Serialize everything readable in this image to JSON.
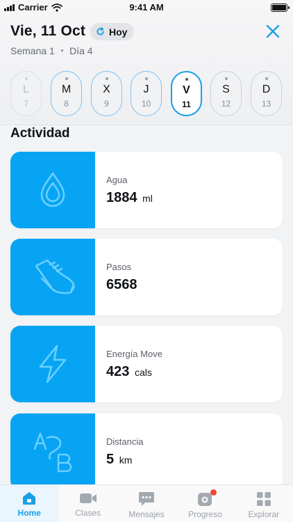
{
  "status_bar": {
    "carrier": "Carrier",
    "time": "9:41 AM"
  },
  "header": {
    "date_title": "Vie, 11 Oct",
    "today_label": "Hoy",
    "week_label": "Semana 1",
    "separator": "•",
    "day_label": "Día 4"
  },
  "week_days": [
    {
      "letter": "L",
      "number": "7"
    },
    {
      "letter": "M",
      "number": "8"
    },
    {
      "letter": "X",
      "number": "9"
    },
    {
      "letter": "J",
      "number": "10"
    },
    {
      "letter": "V",
      "number": "11"
    },
    {
      "letter": "S",
      "number": "12"
    },
    {
      "letter": "D",
      "number": "13"
    }
  ],
  "selected_day": "11",
  "section_title": "Actividad",
  "activity_cards": [
    {
      "label": "Agua",
      "value": "1884",
      "unit": "ml",
      "icon": "water-drop-icon"
    },
    {
      "label": "Pasos",
      "value": "6568",
      "unit": "",
      "icon": "sneaker-icon"
    },
    {
      "label": "Energía Move",
      "value": "423",
      "unit": "cals",
      "icon": "lightning-icon"
    },
    {
      "label": "Distancia",
      "value": "5",
      "unit": "km",
      "icon": "a-to-b-icon"
    }
  ],
  "tab_bar": [
    {
      "label": "Home",
      "icon": "home-icon",
      "active": true
    },
    {
      "label": "Clases",
      "icon": "video-camera-icon",
      "active": false
    },
    {
      "label": "Mensajes",
      "icon": "chat-bubble-icon",
      "active": false
    },
    {
      "label": "Progreso",
      "icon": "camera-progress-icon",
      "active": false,
      "badge": true
    },
    {
      "label": "Explorar",
      "icon": "grid-icon",
      "active": false
    }
  ],
  "colors": {
    "accent": "#1a9fe6",
    "tile": "#07a4f4",
    "badge": "#ef4a3a"
  }
}
